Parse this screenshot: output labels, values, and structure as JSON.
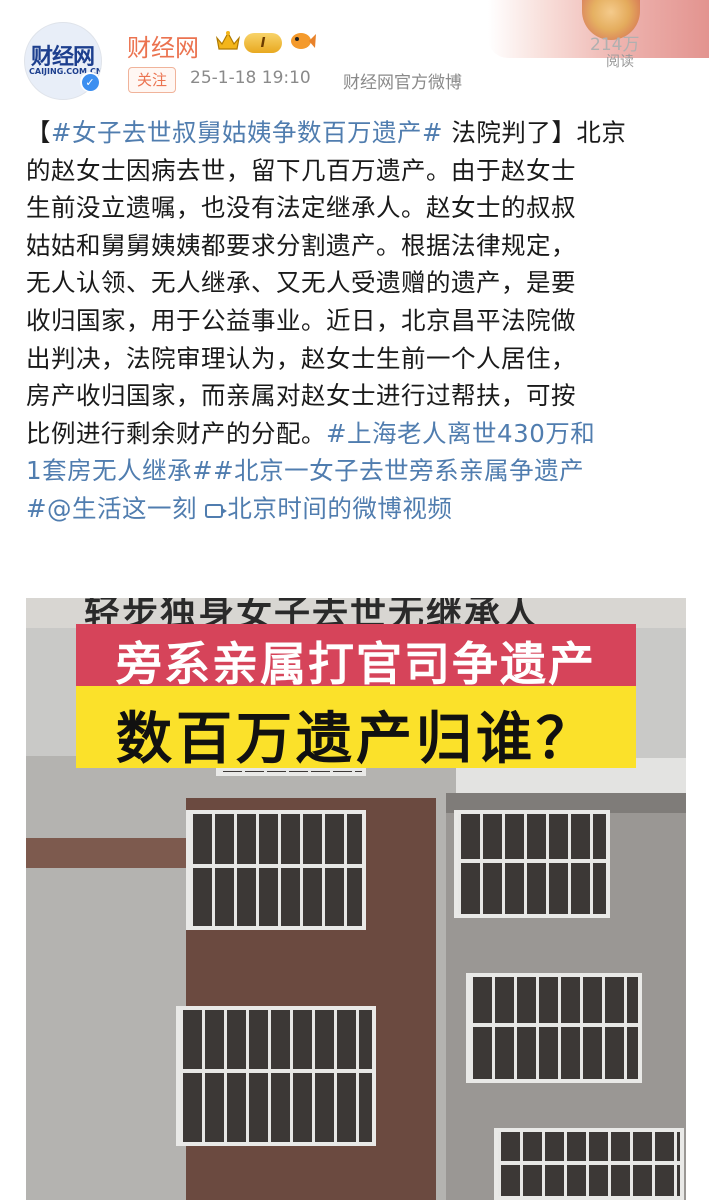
{
  "account": {
    "name": "财经网",
    "avatar_logo": "财经网",
    "avatar_domain": "CAIJING.COM.CN",
    "level_badge": "Ⅰ",
    "follow_label": "关注",
    "time": "25-1-18 19:10",
    "source": "财经网官方微博",
    "read_count": "214万",
    "read_label": "阅读"
  },
  "icons": {
    "crown": "crown-icon",
    "fish": "fish-emoji-icon",
    "verified": "verified-badge-icon",
    "video_link": "video-link-icon"
  },
  "colors": {
    "username": "#eb7350",
    "link": "#507daf",
    "caption_red": "#d6445a",
    "caption_yellow": "#fbe12a"
  },
  "post": {
    "l1_a": "【",
    "l1_tag": "#女子去世叔舅姑姨争数百万遗产#",
    "l1_b": " 法院判了】北京",
    "l2": "的赵女士因病去世，留下几百万遗产。由于赵女士",
    "l3": "生前没立遗嘱，也没有法定继承人。赵女士的叔叔",
    "l4": "姑姑和舅舅姨姨都要求分割遗产。根据法律规定，",
    "l5": "无人认领、无人继承、又无人受遗赠的遗产，是要",
    "l6": "收归国家，用于公益事业。近日，北京昌平法院做",
    "l7": "出判决，法院审理认为，赵女士生前一个人居住，",
    "l8": "房产收归国家，而亲属对赵女士进行过帮扶，可按",
    "l9_text": "比例进行剩余财产的分配。",
    "l9_tag": "#上海老人离世430万和",
    "l10_tag_a": "1套房无人继承#",
    "l10_tag_b": "#北京一女子去世旁系亲属争遗产",
    "l11_tag": "#@生活这一刻",
    "l11_link": "北京时间的微博视频"
  },
  "video": {
    "caption_1": "轻步独身女子去世无继承人",
    "caption_2": "旁系亲属打官司争遗产",
    "caption_3": "数百万遗产归谁？"
  }
}
